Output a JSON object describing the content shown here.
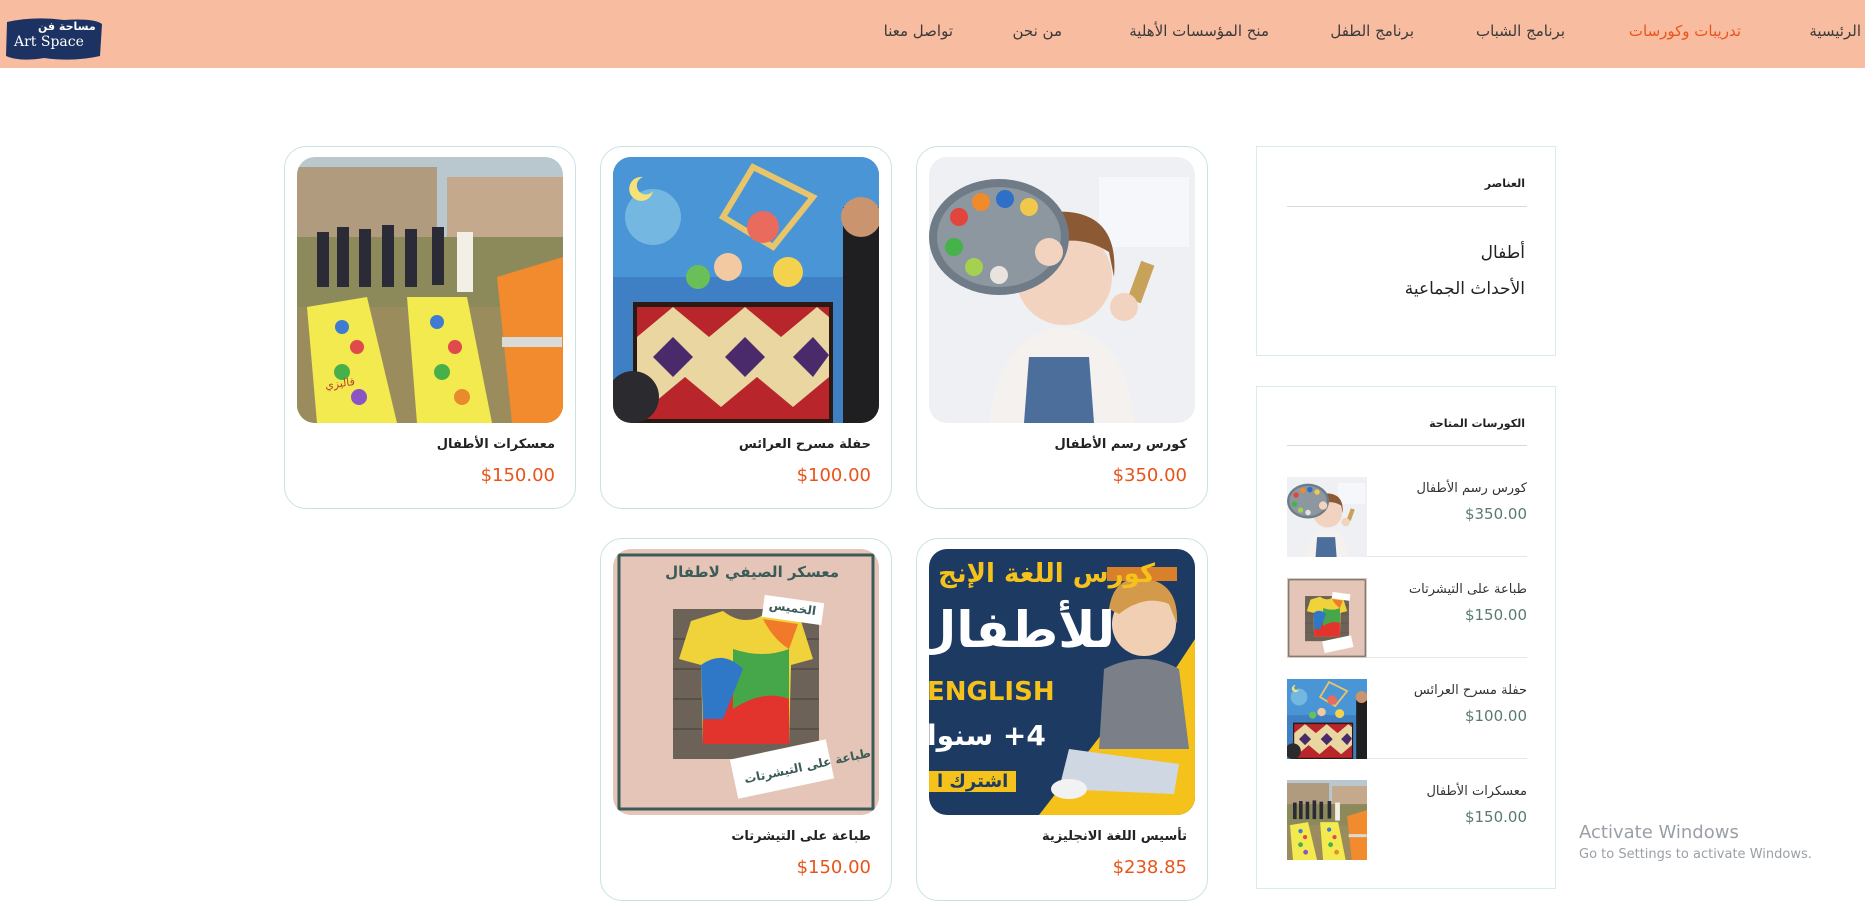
{
  "header": {
    "logo": {
      "arabic": "مساحة فن",
      "latin": "Art Space"
    },
    "nav": [
      {
        "label": "الرئيسية",
        "active": false
      },
      {
        "label": "تدريبات وكورسات",
        "active": true
      },
      {
        "label": "برنامج الشباب",
        "active": false
      },
      {
        "label": "برنامج الطفل",
        "active": false
      },
      {
        "label": "منح المؤسسات الأهلية",
        "active": false
      },
      {
        "label": "من نحن",
        "active": false
      },
      {
        "label": "تواصل معنا",
        "active": false
      }
    ]
  },
  "products": [
    {
      "title": "كورس رسم الأطفال",
      "price": "$350.00",
      "image": "painting-palette-girl"
    },
    {
      "title": "حفلة مسرح العرائس",
      "price": "$100.00",
      "image": "puppet-theater"
    },
    {
      "title": "معسكرات الأطفال",
      "price": "$150.00",
      "image": "kids-camp-field"
    },
    {
      "title": "تأسيس اللغة الانجليزية",
      "price": "$238.85",
      "image": "english-course-banner"
    },
    {
      "title": "طباعة على التيشرتات",
      "price": "$150.00",
      "image": "tie-dye-tshirt"
    }
  ],
  "sidebar": {
    "categories_title": "العناصر",
    "categories": [
      "أطفال",
      "الأحداث الجماعية"
    ],
    "courses_title": "الكورسات المتاحة",
    "courses": [
      {
        "name": "كورس رسم الأطفال",
        "price": "$350.00"
      },
      {
        "name": "طباعة على التيشرتات",
        "price": "$150.00"
      },
      {
        "name": "حفلة مسرح العرائس",
        "price": "$100.00"
      },
      {
        "name": "معسكرات الأطفال",
        "price": "$150.00"
      }
    ]
  },
  "images_text": {
    "english_banner_top": "كورس اللغة الإنج",
    "english_banner_mid": "للأطفال",
    "english_banner_word": "ENGLISH",
    "english_banner_age": "4+ سنوا",
    "english_banner_cta": "اشترك ا",
    "tshirt_top": "معسكر الصيفي لاطفال",
    "tshirt_day": "الخميس",
    "tshirt_bottom": "طباعة على التيشرتات",
    "camp_mat": "فاليزي"
  },
  "watermark": {
    "line1": "Activate Windows",
    "line2": "Go to Settings to activate Windows."
  }
}
